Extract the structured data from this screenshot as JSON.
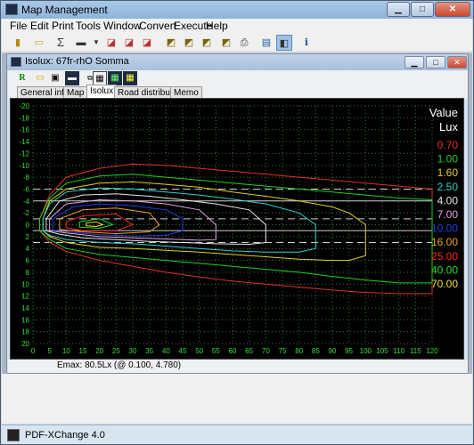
{
  "app": {
    "title": "Map Management"
  },
  "menu": [
    "File",
    "Edit",
    "Print",
    "Tools",
    "Window",
    "Convert",
    "Execute",
    "Help"
  ],
  "child": {
    "title": "Isolux: 67fr-rhO Somma"
  },
  "tabs": [
    "General info",
    "Map",
    "Isolux",
    "Road distribution",
    "Memo"
  ],
  "selected_tab": "Isolux",
  "status": "Emax: 80.5Lx (@  0.100,  4.780)",
  "footer": "PDF-XChange 4.0",
  "legend": {
    "title": "Value",
    "unit": "Lux"
  },
  "chart_data": {
    "type": "line",
    "title": "",
    "xlabel": "",
    "ylabel": "",
    "xlim": [
      0,
      120
    ],
    "ylim": [
      -20,
      20
    ],
    "x_ticks": [
      0,
      5,
      10,
      15,
      20,
      25,
      30,
      35,
      40,
      45,
      50,
      55,
      60,
      65,
      70,
      75,
      80,
      85,
      90,
      95,
      100,
      105,
      110,
      115,
      120
    ],
    "y_ticks": [
      -20,
      -18,
      -16,
      -14,
      -12,
      -10,
      -8,
      -6,
      -4,
      -2,
      0,
      2,
      4,
      6,
      8,
      10,
      12,
      14,
      16,
      18,
      20
    ],
    "reference_lines": [
      {
        "y": -6,
        "style": "dashed"
      },
      {
        "y": -4,
        "style": "solid"
      },
      {
        "y": -1,
        "style": "dashed"
      },
      {
        "y": 1,
        "style": "solid"
      },
      {
        "y": 3,
        "style": "dashed"
      }
    ],
    "series": [
      {
        "name": "0.70",
        "color": "#e03030",
        "x": [
          2,
          5,
          10,
          20,
          30,
          40,
          50,
          60,
          70,
          80,
          90,
          100,
          110,
          120,
          120,
          110,
          100,
          90,
          80,
          70,
          60,
          50,
          40,
          30,
          20,
          10,
          5,
          2
        ],
        "y": [
          -1,
          -5,
          -8,
          -9.5,
          -10.2,
          -10,
          -9.5,
          -9,
          -8.5,
          -8,
          -7.5,
          -7,
          -6.5,
          -6,
          11.6,
          11.6,
          11.4,
          11,
          10.5,
          10,
          9.5,
          8.8,
          8,
          7,
          6,
          4.5,
          3,
          1
        ]
      },
      {
        "name": "1.00",
        "color": "#20d020",
        "x": [
          2,
          5,
          10,
          20,
          30,
          40,
          50,
          60,
          70,
          80,
          90,
          100,
          110,
          120,
          120,
          110,
          100,
          90,
          80,
          70,
          60,
          50,
          40,
          30,
          20,
          10,
          5,
          2
        ],
        "y": [
          -1,
          -4.5,
          -7,
          -8.2,
          -8.5,
          -8,
          -7.5,
          -7,
          -6.5,
          -6,
          -5.5,
          -5,
          -4.5,
          -4.2,
          9.8,
          9.8,
          9.3,
          8.7,
          8,
          7.5,
          7,
          6.5,
          6,
          5.5,
          5,
          4,
          2.5,
          1
        ]
      },
      {
        "name": "1.60",
        "color": "#e0d020",
        "x": [
          3,
          5,
          10,
          20,
          30,
          40,
          50,
          60,
          70,
          80,
          90,
          95,
          100,
          100,
          95,
          90,
          80,
          70,
          60,
          50,
          40,
          30,
          20,
          10,
          5,
          3
        ],
        "y": [
          -1,
          -4,
          -6,
          -7,
          -7.2,
          -6.8,
          -6.3,
          -5.5,
          -4.8,
          -4,
          -3,
          -2,
          0,
          5.2,
          6,
          6,
          5.8,
          5.4,
          5,
          4.6,
          4.3,
          4,
          3.8,
          3,
          2,
          1
        ]
      },
      {
        "name": "2.50",
        "color": "#30d0d0",
        "x": [
          3,
          5,
          10,
          20,
          30,
          40,
          50,
          60,
          70,
          80,
          85,
          85,
          80,
          70,
          60,
          50,
          40,
          30,
          20,
          10,
          5,
          3
        ],
        "y": [
          -1,
          -3.5,
          -5.5,
          -6.2,
          -6,
          -5.5,
          -5,
          -4.3,
          -3.5,
          -2,
          0,
          4,
          4.6,
          4.6,
          4.4,
          4,
          3.6,
          3.2,
          3,
          2.5,
          1.8,
          1
        ]
      },
      {
        "name": "4.00",
        "color": "#e8e8e8",
        "x": [
          4,
          8,
          15,
          25,
          35,
          45,
          55,
          65,
          70,
          70,
          65,
          55,
          45,
          35,
          25,
          15,
          8,
          4
        ],
        "y": [
          -1,
          -4,
          -5,
          -5.2,
          -4.8,
          -4.2,
          -3.5,
          -2.5,
          0,
          3,
          3.3,
          3.2,
          3,
          2.8,
          2.5,
          2.2,
          1.6,
          1
        ]
      },
      {
        "name": "7.00",
        "color": "#e8a0e8",
        "x": [
          5,
          10,
          20,
          30,
          40,
          50,
          55,
          55,
          50,
          40,
          30,
          20,
          10,
          5
        ],
        "y": [
          -1,
          -3.5,
          -4.2,
          -4,
          -3.5,
          -2.5,
          0,
          2.5,
          2.6,
          2.4,
          2.2,
          2,
          1.4,
          1
        ]
      },
      {
        "name": "10.00",
        "color": "#2040e0",
        "x": [
          6,
          12,
          20,
          30,
          40,
          45,
          45,
          40,
          30,
          20,
          12,
          6
        ],
        "y": [
          -1,
          -3,
          -3.5,
          -3.2,
          -2.5,
          -1,
          1,
          1.8,
          1.9,
          1.7,
          1.3,
          1
        ]
      },
      {
        "name": "16.00",
        "color": "#f0a020",
        "x": [
          8,
          15,
          25,
          35,
          38,
          35,
          25,
          15,
          8
        ],
        "y": [
          -1,
          -2.5,
          -2.8,
          -2,
          0,
          1.2,
          1.5,
          1.2,
          0.8
        ]
      },
      {
        "name": "25.00",
        "color": "#ff2020",
        "x": [
          10,
          15,
          25,
          30,
          25,
          15,
          10
        ],
        "y": [
          -0.5,
          -1.5,
          -1.8,
          0,
          1,
          1,
          0.5
        ]
      },
      {
        "name": "40.00",
        "color": "#20e020",
        "x": [
          14,
          20,
          24,
          20,
          14
        ],
        "y": [
          -0.5,
          -1,
          0,
          0.6,
          0.4
        ]
      },
      {
        "name": "70.00",
        "color": "#f0e030",
        "x": [
          16,
          19,
          21,
          19,
          16
        ],
        "y": [
          -0.3,
          -0.5,
          0,
          0.3,
          0.2
        ]
      }
    ]
  }
}
